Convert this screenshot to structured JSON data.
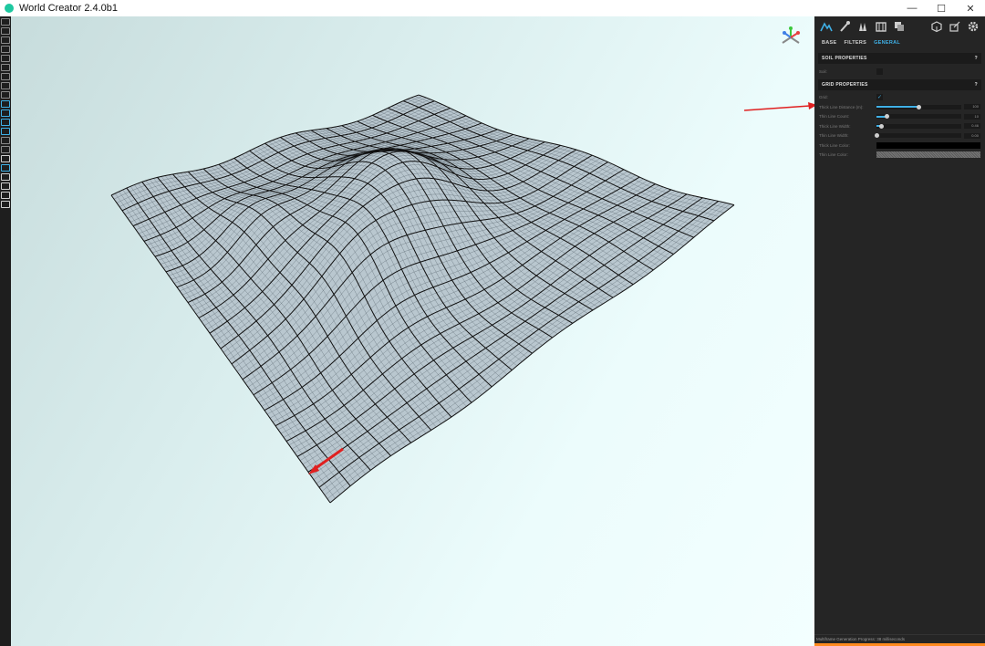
{
  "window": {
    "title": "World Creator 2.4.0b1",
    "controls": {
      "minimize": "—",
      "maximize": "☐",
      "close": "✕"
    }
  },
  "left_toolbar": {
    "tools": [
      {
        "name": "new-file-icon",
        "color": "#8a8a8a"
      },
      {
        "name": "open-file-icon",
        "color": "#8a8a8a"
      },
      {
        "name": "open-recent-icon",
        "color": "#8a8a8a"
      },
      {
        "name": "save-icon",
        "color": "#8a8a8a"
      },
      {
        "name": "save-as-icon",
        "color": "#8a8a8a"
      },
      {
        "name": "export-icon",
        "color": "#8a8a8a"
      },
      {
        "name": "map-icon",
        "color": "#8a8a8a"
      },
      {
        "name": "brush-icon",
        "color": "#8a8a8a"
      },
      {
        "name": "globe-icon",
        "color": "#8a8a8a"
      },
      {
        "name": "terrain-icon",
        "color": "#3fb0e6"
      },
      {
        "name": "paint-icon",
        "color": "#3fb0e6"
      },
      {
        "name": "forest-icon",
        "color": "#3fb0e6"
      },
      {
        "name": "grass-icon",
        "color": "#3fb0e6"
      },
      {
        "name": "path-icon",
        "color": "#8a8a8a"
      },
      {
        "name": "layer-icon",
        "color": "#8a8a8a"
      },
      {
        "name": "cross-icon",
        "color": "#cfcfcf"
      },
      {
        "name": "grid-icon",
        "color": "#3fb0e6"
      },
      {
        "name": "image-icon",
        "color": "#cfcfcf"
      },
      {
        "name": "sphere-icon",
        "color": "#cfcfcf"
      },
      {
        "name": "star-icon",
        "color": "#cfcfcf"
      },
      {
        "name": "hand-icon",
        "color": "#cfcfcf"
      }
    ]
  },
  "panel": {
    "top_icons": [
      "terrain-icon",
      "paint-icon",
      "forest-icon",
      "map-icon",
      "layers-icon",
      "cube-icon",
      "share-icon",
      "gear-icon"
    ],
    "tabs": [
      {
        "label": "BASE",
        "active": false
      },
      {
        "label": "FILTERS",
        "active": false
      },
      {
        "label": "GENERAL",
        "active": true
      }
    ],
    "soil_section": {
      "title": "SOIL PROPERTIES",
      "help": "?",
      "soil_label": "Soil:"
    },
    "grid_section": {
      "title": "GRID PROPERTIES",
      "help": "?",
      "grid_label": "Grid:",
      "grid_check": "✓",
      "thick_line_distance": {
        "label": "Thick Line Distance (m):",
        "value": "100",
        "level": 0.5
      },
      "thin_line_count": {
        "label": "Thin Line Count:",
        "value": "10",
        "level": 0.12
      },
      "thick_line_width": {
        "label": "Thick Line Width:",
        "value": "0.46",
        "level": 0.06
      },
      "thin_line_width": {
        "label": "Thin Line Width:",
        "value": "0.00",
        "level": 0.0
      },
      "thick_line_color": {
        "label": "Thick Line Color:",
        "color": "#000000"
      },
      "thin_line_color": {
        "label": "Thin Line Color:",
        "color": "#777777"
      }
    },
    "status": "Multiframe Generation Progress: 38 milliseconds",
    "progress_color": "#ff8a1e"
  },
  "viewport": {
    "gizmo_icon": "axis-gizmo-icon"
  }
}
